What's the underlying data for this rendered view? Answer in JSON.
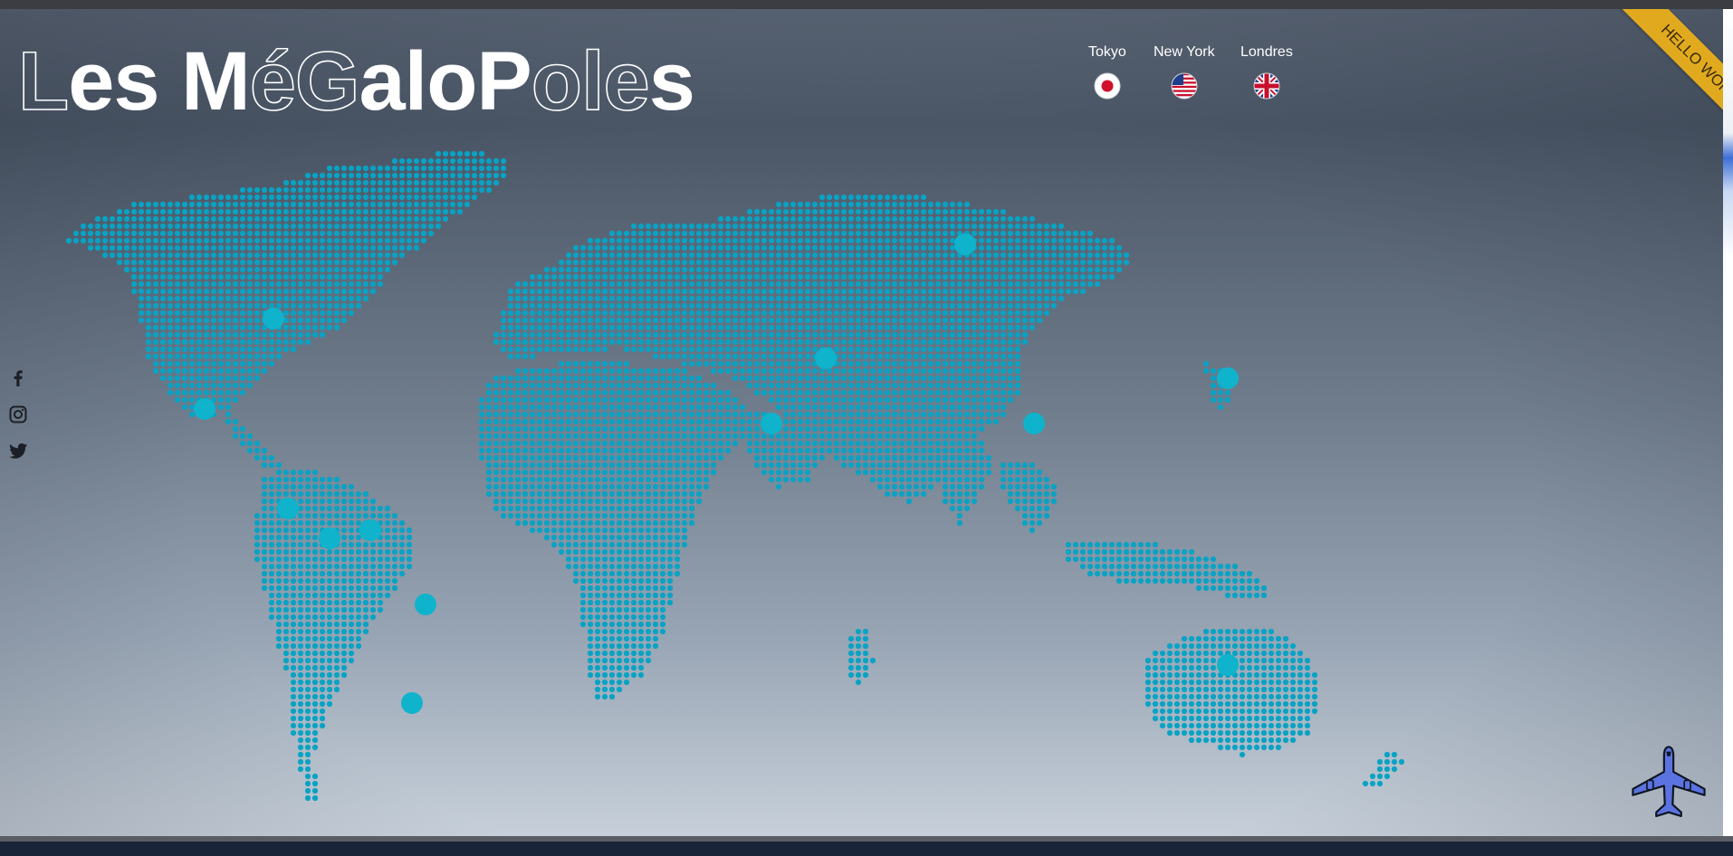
{
  "header": {
    "title_parts": [
      {
        "text": "L",
        "style": "outline"
      },
      {
        "text": "es M",
        "style": "solid"
      },
      {
        "text": "éG",
        "style": "outline"
      },
      {
        "text": "aloP",
        "style": "solid"
      },
      {
        "text": "ole",
        "style": "outline"
      },
      {
        "text": "s",
        "style": "solid"
      }
    ]
  },
  "cities": [
    {
      "label": "Tokyo",
      "flag": "japan-flag-icon"
    },
    {
      "label": "New York",
      "flag": "usa-flag-icon"
    },
    {
      "label": "Londres",
      "flag": "uk-flag-icon"
    }
  ],
  "ribbon": {
    "text": "HELLO WORLD",
    "color": "#e1aa1e"
  },
  "social": [
    {
      "name": "facebook",
      "icon": "facebook-icon"
    },
    {
      "name": "instagram",
      "icon": "instagram-icon"
    },
    {
      "name": "twitter",
      "icon": "twitter-icon"
    }
  ],
  "map": {
    "dot_color": "#08a3c4",
    "hotspot_color": "#0fb3cc",
    "hotspots": [
      "north-america-canada",
      "north-america-mexico",
      "central-america",
      "south-america-colombia",
      "south-america-venezuela",
      "south-america-brazil",
      "south-america-south",
      "africa-north",
      "europe-mediterranean",
      "russia",
      "asia-india",
      "asia-japan",
      "australia"
    ]
  },
  "plane": {
    "icon": "airplane-icon",
    "color": "#5b73e0"
  },
  "colors": {
    "text": "#ffffff",
    "background_top": "#4a5666",
    "background_bottom": "#c7d0da"
  }
}
